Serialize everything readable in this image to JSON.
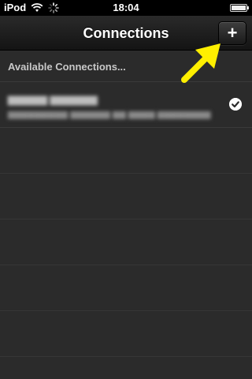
{
  "status_bar": {
    "carrier": "iPod",
    "time": "18:04",
    "battery_level": 1.0,
    "icons": [
      "wifi-icon",
      "spinner-icon",
      "battery-icon"
    ]
  },
  "nav_bar": {
    "title": "Connections",
    "add_button_label": "+"
  },
  "section": {
    "header": "Available Connections..."
  },
  "connections": [
    {
      "name": "",
      "detail": "",
      "selected": true,
      "status_icon": "checkmark-icon"
    }
  ],
  "annotation": {
    "arrow_color": "#ffef00"
  },
  "colors": {
    "background": "#2b2b2b",
    "status_bar": "#000000",
    "accent": "#ffffff"
  }
}
